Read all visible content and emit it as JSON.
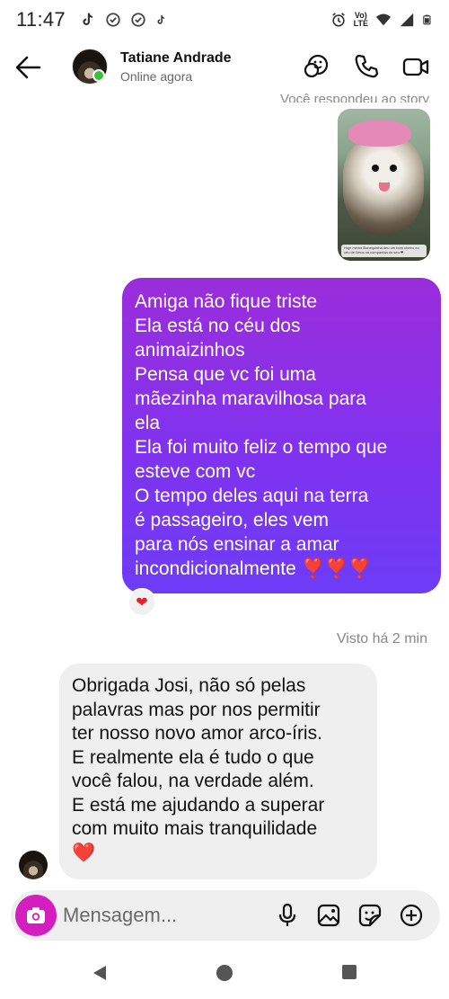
{
  "status_bar": {
    "time": "11:47",
    "volte_label": "Vo)\nLTE"
  },
  "header": {
    "contact_name": "Tatiane Andrade",
    "contact_status": "Online agora"
  },
  "story_reply": {
    "note": "Você respondeu ao story",
    "caption": "Hoje minha Bonequinha deu um bom cheiro no céu de Deus na companhia do seu ❤"
  },
  "messages": [
    {
      "direction": "sent",
      "lines": [
        "Amiga não fique triste",
        "Ela está no céu dos",
        "animaizinhos",
        "Pensa que vc foi uma",
        "mãezinha maravilhosa para",
        "ela",
        "Ela foi muito feliz o tempo que",
        "esteve com vc",
        "O tempo deles aqui na terra",
        "é passageiro, eles vem",
        "para nós ensinar a amar",
        "incondicionalmente ❣️❣️❣️"
      ],
      "reaction": "❤"
    },
    {
      "direction": "received",
      "lines": [
        "Obrigada Josi, não só pelas",
        "palavras mas por nos permitir",
        "ter nosso novo amor arco-íris.",
        "E realmente ela é tudo o que",
        "você falou, na verdade além.",
        "E está me ajudando a superar",
        "com muito mais tranquilidade",
        "❤️"
      ]
    }
  ],
  "seen": "Visto há 2 min",
  "composer": {
    "placeholder": "Mensagem..."
  },
  "colors": {
    "sent_bubble_top": "#9a2ddb",
    "sent_bubble_bottom": "#6d3cf6",
    "camera_button": "#d41ec0",
    "online_dot": "#3bbf3b"
  }
}
